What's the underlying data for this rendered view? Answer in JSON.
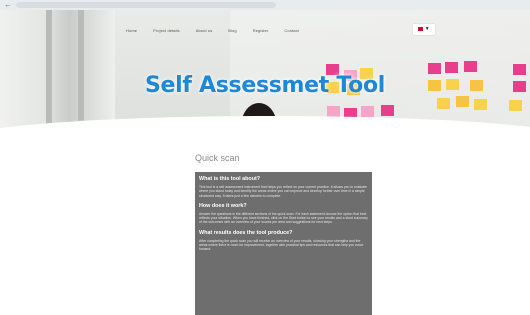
{
  "browser": {
    "back_icon": "arrow-left-icon"
  },
  "nav": {
    "items": [
      "Home",
      "Project details",
      "About us",
      "Blog",
      "Register",
      "Contact"
    ]
  },
  "language": {
    "label": "▼",
    "icon": "flag-icon"
  },
  "hero": {
    "title": "Self Assessmet Tool",
    "sticky_colors": [
      "#e83e8c",
      "#f7d24a",
      "#f4a6c8",
      "#f6c343"
    ]
  },
  "section": {
    "title": "Quick scan"
  },
  "faq": [
    {
      "question": "What is this tool about?",
      "answer": "This tool is a self assessment instrument that helps you reflect on your current practice. It allows you to evaluate where you stand today and identify the areas where you can improve and develop further over time in a simple structured way. It takes just a few minutes to complete."
    },
    {
      "question": "How does it work?",
      "answer": "Answer the questions in the different sections of the quick scan. For each statement choose the option that best reflects your situation. When you have finished, click on the Start button to see your results and a short summary of the outcomes with an overview of your scores per area and suggestions for next steps."
    },
    {
      "question": "What results does the tool produce?",
      "answer": "After completing the quick scan you will receive an overview of your results, showing your strengths and the areas where there is room for improvement, together with practical tips and resources that can help you move forward."
    }
  ]
}
